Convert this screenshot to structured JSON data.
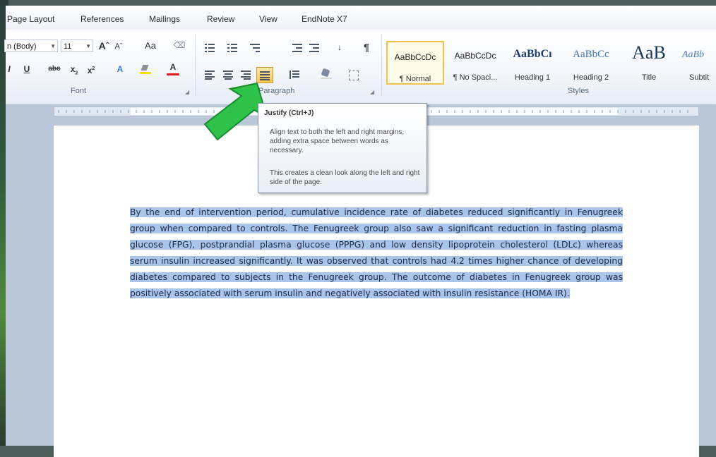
{
  "tabs": [
    "Page Layout",
    "References",
    "Mailings",
    "Review",
    "View",
    "EndNote X7"
  ],
  "font_group": {
    "font_name": "n (Body)",
    "font_size": "11",
    "grow_label": "Aˆ",
    "shrink_label": "Aˇ",
    "change_case_label": "Aa",
    "label": "Font"
  },
  "paragraph_group": {
    "label": "Paragraph"
  },
  "styles_group": {
    "label": "Styles",
    "items": [
      {
        "sample": "AaBbCcDc",
        "name": "¶ Normal"
      },
      {
        "sample": "AaBbCcDc",
        "name": "¶ No Spaci..."
      },
      {
        "sample": "AaBbCı",
        "name": "Heading 1"
      },
      {
        "sample": "AaBbCc",
        "name": "Heading 2"
      },
      {
        "sample": "AaB",
        "name": "Title"
      },
      {
        "sample": "AaBb",
        "name": "Subtit"
      }
    ]
  },
  "tooltip": {
    "title": "Justify (Ctrl+J)",
    "body1": "Align text to both the left and right margins, adding extra space between words as necessary.",
    "body2": "This creates a clean look along the left and right side of the page."
  },
  "document": {
    "text": "By the end of intervention period, cumulative incidence rate of diabetes reduced significantly in Fenugreek group when compared to controls. The Fenugreek group also saw a significant reduction in fasting plasma glucose (FPG), postprandial plasma glucose (PPPG) and low density lipoprotein cholesterol (LDLc) whereas serum insulin increased significantly. It was observed that controls had 4.2 times higher chance of developing diabetes compared to subjects in the Fenugreek group. The outcome of diabetes in Fenugreek group was positively associated with serum insulin and negatively associated with insulin resistance (HOMA IR)."
  },
  "colors": {
    "selection": "#a9c5ea",
    "arrow": "#2fc24a",
    "active_button": "#f8c44e"
  }
}
